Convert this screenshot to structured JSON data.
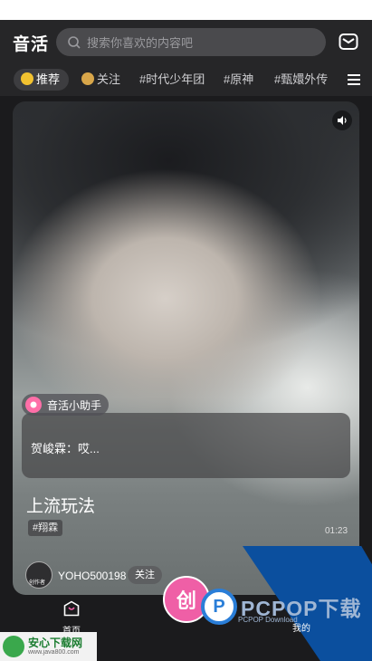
{
  "app": {
    "logo": "音活"
  },
  "search": {
    "placeholder": "搜索你喜欢的内容吧"
  },
  "tabs": [
    {
      "label": "推荐",
      "active": true
    },
    {
      "label": "关注",
      "active": false
    },
    {
      "label": "#时代少年团",
      "active": false
    },
    {
      "label": "#原神",
      "active": false
    },
    {
      "label": "#甄嬛外传",
      "active": false
    }
  ],
  "post": {
    "assistant_name": "音活小助手",
    "comment": "贺峻霖：哎...",
    "title": "上流玩法",
    "hashtag": "#翔霖",
    "duration": "01:23",
    "author_name": "YOHO500198",
    "avatar_label": "创作者",
    "follow_label": "关注"
  },
  "bottom_nav": {
    "home": "首页",
    "mine": "我的"
  },
  "watermarks": {
    "juben": "创",
    "pcpop": "PCPOP下载",
    "pcpop_sub": "PCPOP Download",
    "anxin": "安心下载网",
    "anxin_url": "www.java800.com"
  },
  "colors": {
    "accent_pink": "#ef5fa6",
    "pcpop_blue": "#0b4f9e"
  }
}
